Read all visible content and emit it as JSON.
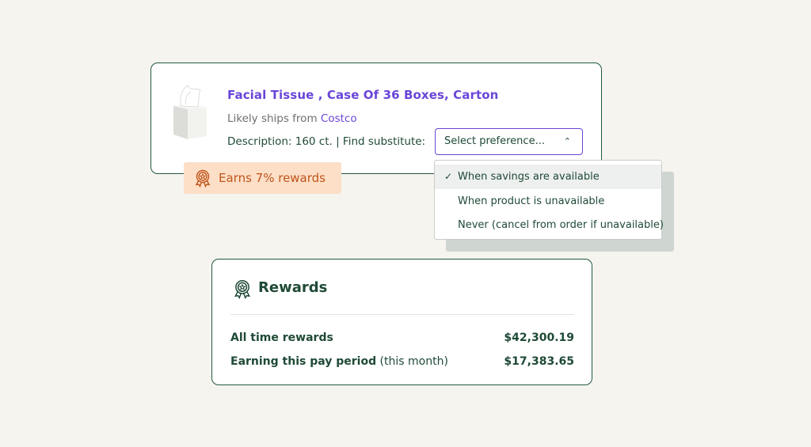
{
  "product": {
    "title": "Facial Tissue , Case Of 36 Boxes, Carton",
    "ships_prefix": "Likely ships from ",
    "ships_store": "Costco",
    "description": "Description: 160 ct. |  Find substitute:",
    "select_placeholder": "Select preference...",
    "caret_icon": "chevron-up-icon"
  },
  "badge": {
    "label": "Earns 7% rewards",
    "icon": "award-ribbon-icon"
  },
  "dropdown": {
    "options": [
      {
        "label": "When savings are available",
        "selected": true
      },
      {
        "label": "When product is unavailable",
        "selected": false
      },
      {
        "label": "Never (cancel from order if unavailable)",
        "selected": false
      }
    ],
    "check_glyph": "✓"
  },
  "rewards": {
    "title": "Rewards",
    "rows": [
      {
        "label": "All time rewards",
        "sub": "",
        "value": "$42,300.19"
      },
      {
        "label": "Earning this pay period",
        "sub": " (this month)",
        "value": "$17,383.65"
      }
    ]
  },
  "colors": {
    "accent_purple": "#6a46d8",
    "dark_green": "#1f4a36",
    "badge_bg": "#fcdfc6",
    "badge_text": "#c0541c",
    "background": "#f6f4ef"
  }
}
